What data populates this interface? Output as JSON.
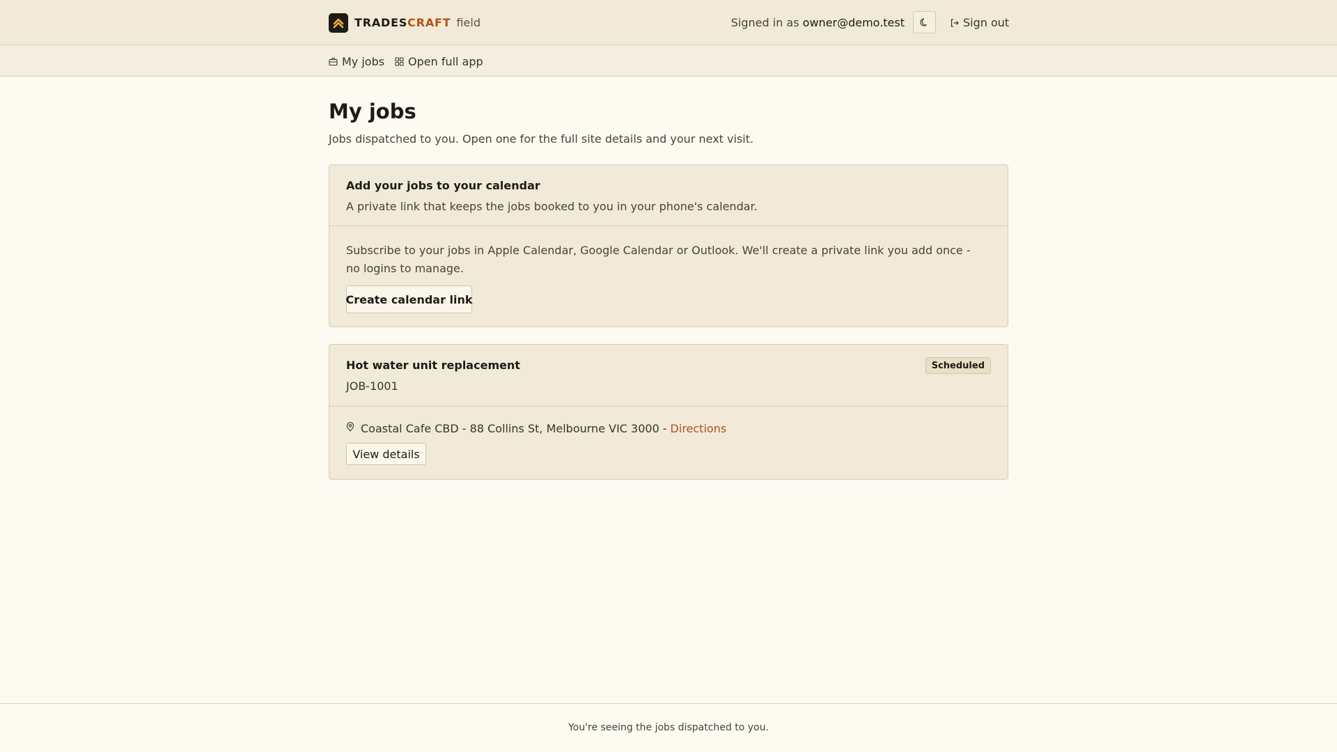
{
  "header": {
    "brand_primary": "TRADES",
    "brand_accent": "CRAFT",
    "brand_suffix": "field",
    "signed_in_prefix": "Signed in as",
    "user_email": "owner@demo.test",
    "theme_toggle_icon": "moon-icon",
    "sign_out_label": "Sign out"
  },
  "nav": {
    "items": [
      {
        "label": "My jobs",
        "icon": "briefcase-icon"
      },
      {
        "label": "Open full app",
        "icon": "grid-icon"
      }
    ]
  },
  "page": {
    "title": "My jobs",
    "description": "Jobs dispatched to you. Open one for the full site details and your next visit."
  },
  "calendar_card": {
    "title": "Add your jobs to your calendar",
    "subtitle": "A private link that keeps the jobs booked to you in your phone's calendar.",
    "body": "Subscribe to your jobs in Apple Calendar, Google Calendar or Outlook. We'll create a private link you add once - no logins to manage.",
    "button_label": "Create calendar link"
  },
  "jobs": [
    {
      "title": "Hot water unit replacement",
      "job_number": "JOB-1001",
      "status": "Scheduled",
      "address": "Coastal Cafe CBD - 88 Collins St, Melbourne VIC 3000",
      "separator": "-",
      "directions_label": "Directions",
      "view_details_label": "View details"
    }
  ],
  "footer": {
    "text": "You're seeing the jobs dispatched to you."
  },
  "colors": {
    "accent": "#b4501a",
    "logo_bg": "#1e1b16",
    "logo_mark": "#f2b33d",
    "page_bg": "#fdfaf2",
    "card_bg": "#f1ead8"
  }
}
